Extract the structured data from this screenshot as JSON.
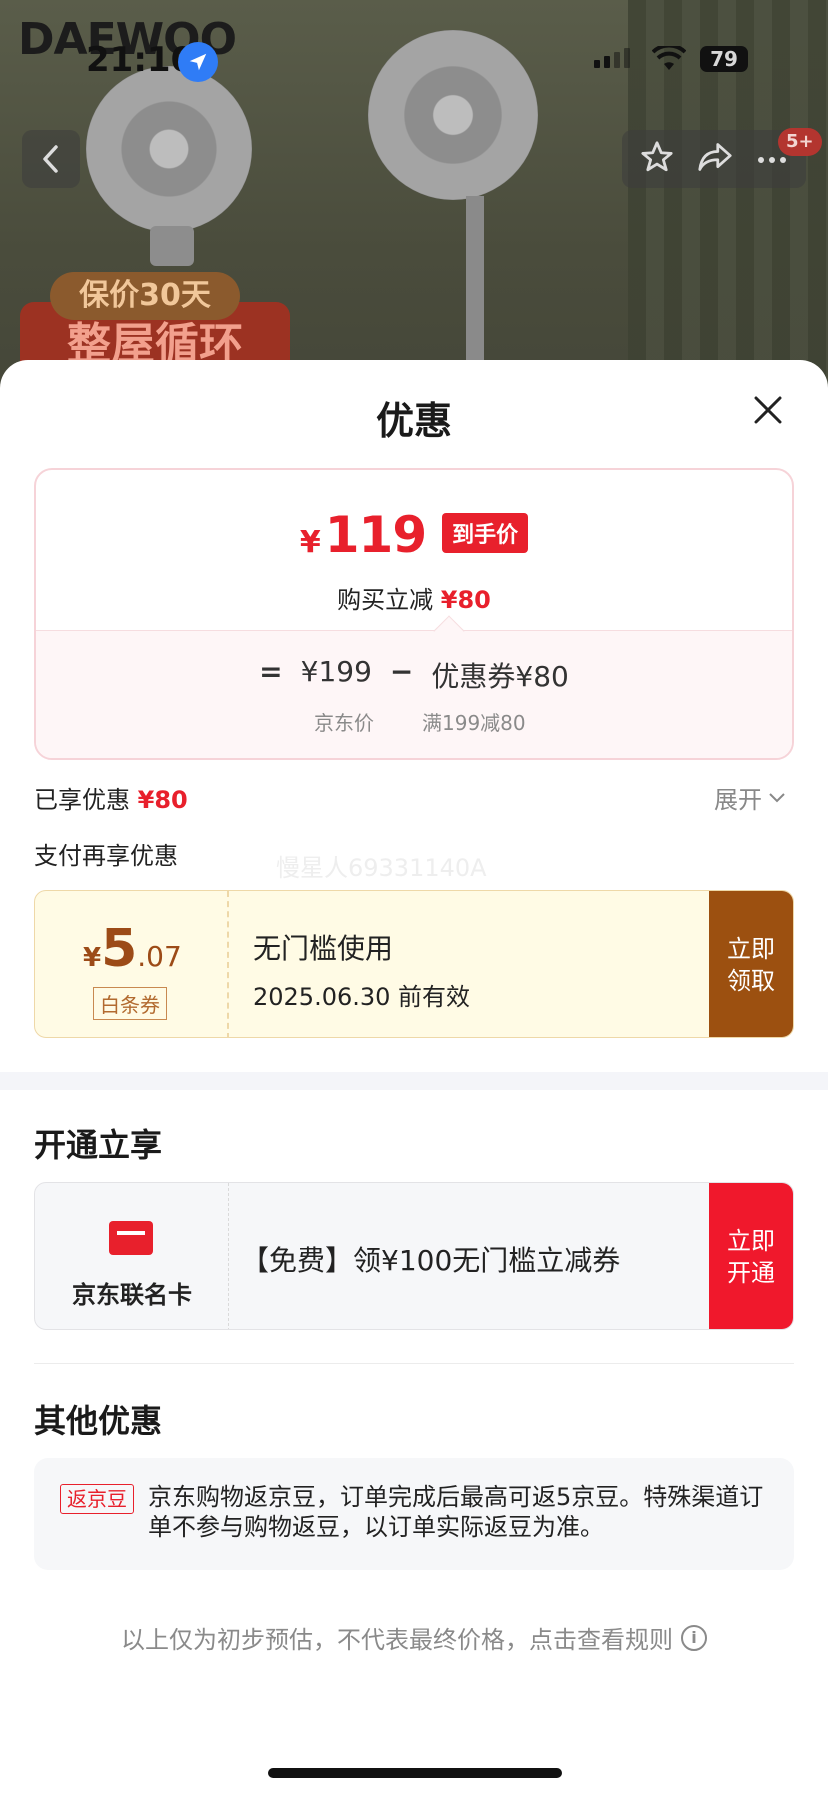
{
  "background": {
    "brand": "DAEWOO",
    "promo_top": "保价30天",
    "promo_bottom": "整屋循环"
  },
  "status_bar": {
    "time": "21:10",
    "battery": "79"
  },
  "top_nav": {
    "badge": "5+"
  },
  "sheet": {
    "title": "优惠",
    "price_card": {
      "yen": "¥",
      "final_price": "119",
      "final_tag": "到手价",
      "discount_label": "购买立减",
      "discount_value": "¥80",
      "equals": "=",
      "jd_price": "¥199",
      "minus": "−",
      "coupon_part": "优惠券¥80",
      "jd_price_label": "京东价",
      "coupon_rule": "满199减80"
    },
    "enjoyed_label": "已享优惠",
    "enjoyed_value": "¥80",
    "expand_label": "展开",
    "pay_more_label": "支付再享优惠",
    "watermark": "慢星人69331140A",
    "coupon": {
      "yen": "¥",
      "amount_int": "5",
      "amount_dec": ".07",
      "type": "白条券",
      "title": "无门槛使用",
      "date": "2025.06.30 前有效",
      "claim": "立即领取"
    },
    "open_section": {
      "title": "开通立享",
      "card_label": "京东联名卡",
      "offer": "【免费】领¥100无门槛立减券",
      "open": "立即开通"
    },
    "other_section": {
      "title": "其他优惠",
      "tag": "返京豆",
      "text": "京东购物返京豆，订单完成后最高可返5京豆。特殊渠道订单不参与购物返豆，以订单实际返豆为准。"
    },
    "footer_note": "以上仅为初步预估，不代表最终价格，点击查看规则",
    "colors": {
      "accent_red": "#e8202c",
      "coupon_brown": "#9c5010"
    }
  }
}
